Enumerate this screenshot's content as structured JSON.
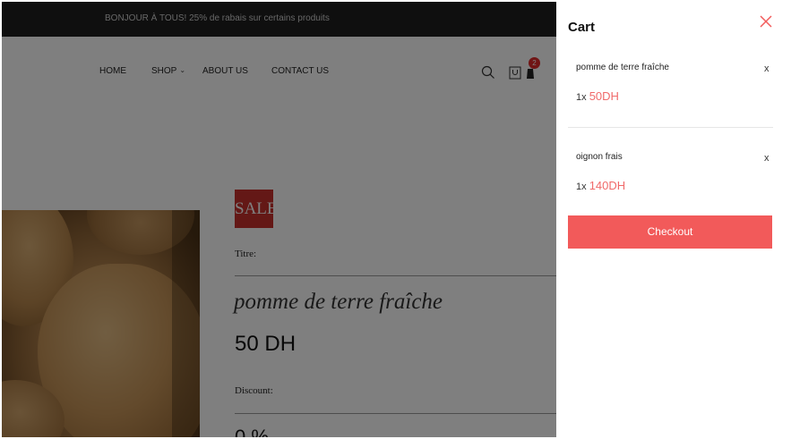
{
  "announcement": {
    "text": "BONJOUR À TOUS! 25% de rabais sur certains produits"
  },
  "nav": {
    "home": "HOME",
    "shop": "SHOP",
    "about": "ABOUT US",
    "contact": "CONTACT US",
    "cart_count": "2"
  },
  "product": {
    "badge": "SALE",
    "title_label": "Titre:",
    "name": "pomme de terre fraîche",
    "price": "50 DH",
    "discount_label": "Discount:",
    "discount_value": "0 %"
  },
  "cart": {
    "title": "Cart",
    "items": [
      {
        "name": "pomme de terre fraîche",
        "qty": "1x",
        "price": "50DH",
        "remove": "x"
      },
      {
        "name": "oignon frais",
        "qty": "1x",
        "price": "140DH",
        "remove": "x"
      }
    ],
    "checkout_label": "Checkout"
  },
  "colors": {
    "accent": "#f25a5a",
    "sale_badge": "#c9302c",
    "price_text": "#f06a6a",
    "announcement_bg": "#1e1e1e"
  },
  "icons": [
    "search-icon",
    "bag-icon",
    "cart-icon",
    "close-icon",
    "chevron-down-icon"
  ]
}
